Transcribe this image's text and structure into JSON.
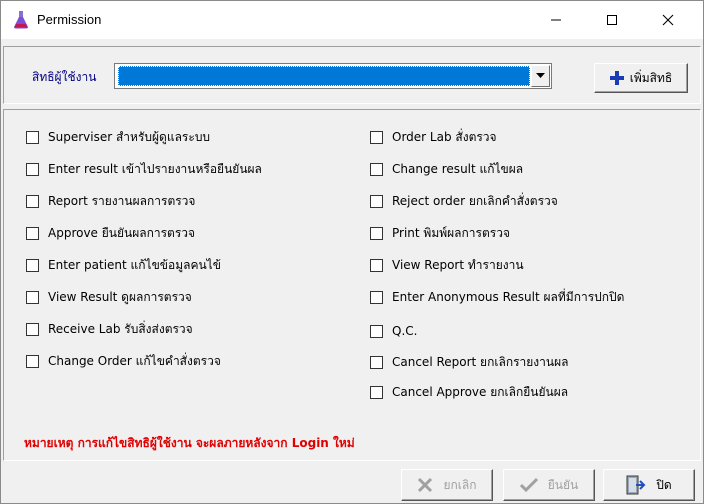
{
  "window": {
    "title": "Permission"
  },
  "header": {
    "right_label": "สิทธิผู้ใช้งาน",
    "right_selected": "",
    "add_button_label": "เพิ่มสิทธิ"
  },
  "permissions_left": [
    {
      "label": "Superviser สำหรับผู้ดูแลระบบ",
      "checked": false
    },
    {
      "label": "Enter result เข้าไปรายงานหรือยืนยันผล",
      "checked": false
    },
    {
      "label": "Report รายงานผลการตรวจ",
      "checked": false
    },
    {
      "label": "Approve ยืนยันผลการตรวจ",
      "checked": false
    },
    {
      "label": "Enter patient แก้ไขข้อมูลคนไข้",
      "checked": false
    },
    {
      "label": "View Result ดูผลการตรวจ",
      "checked": false
    },
    {
      "label": "Receive Lab รับสิ่งส่งตรวจ",
      "checked": false
    },
    {
      "label": "Change Order แก้ไขคำสั่งตรวจ",
      "checked": false
    }
  ],
  "permissions_right": [
    {
      "label": "Order Lab สั่งตรวจ",
      "checked": false
    },
    {
      "label": "Change result แก้ไขผล",
      "checked": false
    },
    {
      "label": "Reject order ยกเลิกคำสั่งตรวจ",
      "checked": false
    },
    {
      "label": "Print พิมพ์ผลการตรวจ",
      "checked": false
    },
    {
      "label": "View Report ทำรายงาน",
      "checked": false
    },
    {
      "label": "Enter Anonymous Result ผลที่มีการปกปิด",
      "checked": false
    },
    {
      "label": "Q.C.",
      "checked": false
    },
    {
      "label": "Cancel Report ยกเลิกรายงานผล",
      "checked": false
    },
    {
      "label": "Cancel Approve ยกเลิกยืนยันผล",
      "checked": false
    }
  ],
  "note": "หมายเหตุ การแก้ไขสิทธิผู้ใช้งาน จะผลภายหลังจาก Login ใหม่",
  "footer": {
    "cancel_label": "ยกเลิก",
    "confirm_label": "ยืนยัน",
    "close_label": "ปิด"
  },
  "colors": {
    "selection": "#0078d7",
    "note": "#e00000",
    "label_blue": "#000080"
  }
}
